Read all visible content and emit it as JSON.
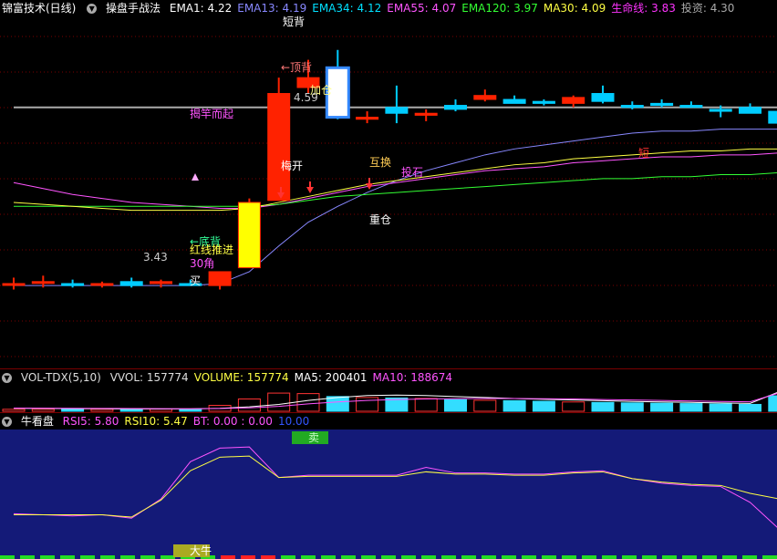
{
  "header": {
    "title": "锦富技术(日线)",
    "indicator": "操盘手战法",
    "items": [
      {
        "label": "EMA1:",
        "value": "4.22",
        "color": "#ffffff"
      },
      {
        "label": "EMA13:",
        "value": "4.19",
        "color": "#8888ff"
      },
      {
        "label": "EMA34:",
        "value": "4.12",
        "color": "#00e0ff"
      },
      {
        "label": "EMA55:",
        "value": "4.07",
        "color": "#ff55ff"
      },
      {
        "label": "EMA120:",
        "value": "3.97",
        "color": "#33ff33"
      },
      {
        "label": "MA30:",
        "value": "4.09",
        "color": "#ffff44"
      },
      {
        "label": "生命线:",
        "value": "3.83",
        "color": "#ff33ff"
      },
      {
        "label": "投资:",
        "value": "4.30",
        "color": "#aaaaaa"
      }
    ]
  },
  "vol_header": {
    "name": "VOL-TDX(5,10)",
    "items": [
      {
        "label": "VVOL:",
        "value": "157774",
        "color": "#dddddd"
      },
      {
        "label": "VOLUME:",
        "value": "157774",
        "color": "#ffff44"
      },
      {
        "label": "MA5:",
        "value": "200401",
        "color": "#ffffff"
      },
      {
        "label": "MA10:",
        "value": "188674",
        "color": "#ff55ff"
      }
    ]
  },
  "rsi_header": {
    "name": "牛看盘",
    "items": [
      {
        "label": "RSI5:",
        "value": "5.80",
        "color": "#ff55ff"
      },
      {
        "label": "RSI10:",
        "value": "5.47",
        "color": "#ffff44"
      },
      {
        "label": "BT:",
        "value": "0.00 : 0.00",
        "color": "#ff55ff"
      },
      {
        "label": "",
        "value": "10.00",
        "color": "#3355ff"
      }
    ]
  },
  "annotations": {
    "top_cut": "短背",
    "top_div": "←顶背",
    "add_pos": "加仓",
    "high_price": "4.59",
    "jiegan": "揭竿而起",
    "meikai": "梅开",
    "huhuan": "互换",
    "toushi": "投石",
    "zhongcang": "重仓",
    "short_label": "短",
    "bottom_div": "←底背",
    "advance": "红线推进",
    "angle": "30角",
    "buy": "买",
    "low_price": "3.43",
    "sell_mark": "卖",
    "bull_mark": "大牛"
  },
  "colors": {
    "up": "#ff2200",
    "down": "#00ccff",
    "grid": "#7a0000"
  },
  "chart_data": [
    {
      "type": "candlestick",
      "name": "price",
      "ylim": [
        3.0,
        4.75
      ],
      "ohlc": [
        [
          3.41,
          3.44,
          3.38,
          3.41
        ],
        [
          3.42,
          3.45,
          3.39,
          3.42
        ],
        [
          3.41,
          3.43,
          3.39,
          3.4
        ],
        [
          3.41,
          3.42,
          3.39,
          3.41
        ],
        [
          3.42,
          3.44,
          3.39,
          3.4
        ],
        [
          3.41,
          3.43,
          3.39,
          3.42
        ],
        [
          3.41,
          3.43,
          3.4,
          3.4
        ],
        [
          3.4,
          3.47,
          3.38,
          3.47
        ],
        [
          3.49,
          3.84,
          3.49,
          3.82
        ],
        [
          3.83,
          4.45,
          3.83,
          4.37
        ],
        [
          4.4,
          4.54,
          4.37,
          4.45
        ],
        [
          4.5,
          4.59,
          4.24,
          4.25
        ],
        [
          4.24,
          4.28,
          4.22,
          4.25
        ],
        [
          4.3,
          4.41,
          4.22,
          4.27
        ],
        [
          4.26,
          4.29,
          4.23,
          4.27
        ],
        [
          4.31,
          4.34,
          4.28,
          4.29
        ],
        [
          4.34,
          4.39,
          4.33,
          4.36
        ],
        [
          4.34,
          4.36,
          4.32,
          4.32
        ],
        [
          4.33,
          4.34,
          4.31,
          4.32
        ],
        [
          4.32,
          4.36,
          4.3,
          4.35
        ],
        [
          4.37,
          4.41,
          4.32,
          4.33
        ],
        [
          4.31,
          4.33,
          4.29,
          4.3
        ],
        [
          4.32,
          4.34,
          4.3,
          4.31
        ],
        [
          4.31,
          4.33,
          4.3,
          4.3
        ],
        [
          4.29,
          4.31,
          4.25,
          4.28
        ],
        [
          4.3,
          4.32,
          4.27,
          4.27
        ],
        [
          4.28,
          4.31,
          4.19,
          4.22
        ]
      ],
      "ma_lines": {
        "EMA13": [
          3.4,
          3.4,
          3.4,
          3.4,
          3.4,
          3.4,
          3.4,
          3.41,
          3.47,
          3.6,
          3.72,
          3.8,
          3.87,
          3.93,
          3.98,
          4.02,
          4.06,
          4.09,
          4.11,
          4.13,
          4.15,
          4.17,
          4.18,
          4.18,
          4.19,
          4.19,
          4.19
        ],
        "EMA55": [
          3.92,
          3.89,
          3.86,
          3.84,
          3.82,
          3.81,
          3.8,
          3.79,
          3.79,
          3.81,
          3.84,
          3.87,
          3.9,
          3.92,
          3.94,
          3.96,
          3.98,
          3.99,
          4.0,
          4.02,
          4.03,
          4.04,
          4.05,
          4.05,
          4.06,
          4.06,
          4.07
        ],
        "EMA120": [
          3.8,
          3.8,
          3.8,
          3.8,
          3.8,
          3.8,
          3.8,
          3.8,
          3.8,
          3.81,
          3.83,
          3.85,
          3.86,
          3.87,
          3.88,
          3.89,
          3.9,
          3.91,
          3.92,
          3.93,
          3.94,
          3.94,
          3.95,
          3.95,
          3.96,
          3.96,
          3.97
        ],
        "MA30": [
          3.82,
          3.81,
          3.8,
          3.79,
          3.78,
          3.78,
          3.78,
          3.78,
          3.79,
          3.82,
          3.85,
          3.88,
          3.91,
          3.93,
          3.95,
          3.97,
          3.99,
          4.01,
          4.02,
          4.04,
          4.05,
          4.06,
          4.07,
          4.08,
          4.08,
          4.09,
          4.09
        ],
        "投资": [
          4.3,
          4.3,
          4.3,
          4.3,
          4.3,
          4.3,
          4.3,
          4.3,
          4.3,
          4.3,
          4.3,
          4.3,
          4.3,
          4.3,
          4.3,
          4.3,
          4.3,
          4.3,
          4.3,
          4.3,
          4.3,
          4.3,
          4.3,
          4.3,
          4.3,
          4.3,
          4.3
        ]
      }
    },
    {
      "type": "bar",
      "name": "volume",
      "ylim": [
        0,
        260000
      ],
      "values": [
        20000,
        21000,
        19000,
        20000,
        21000,
        22000,
        23000,
        60000,
        125000,
        185000,
        180000,
        150000,
        140000,
        135000,
        130000,
        118000,
        112000,
        108000,
        102000,
        95000,
        90000,
        85000,
        82000,
        78000,
        74000,
        70000,
        157774
      ],
      "ma5": [
        30000,
        29000,
        27000,
        25000,
        24000,
        23000,
        24000,
        30000,
        45000,
        70000,
        110000,
        140000,
        160000,
        165000,
        160000,
        150000,
        140000,
        130000,
        122000,
        115000,
        108000,
        100000,
        95000,
        90000,
        85000,
        80000,
        200401
      ],
      "ma10": [
        32000,
        31000,
        30000,
        29000,
        28000,
        27000,
        26000,
        28000,
        35000,
        50000,
        75000,
        95000,
        110000,
        120000,
        125000,
        128000,
        130000,
        130000,
        128000,
        125000,
        120000,
        115000,
        110000,
        105000,
        100000,
        96000,
        188674
      ]
    },
    {
      "type": "line",
      "name": "rsi",
      "ylim": [
        0,
        100
      ],
      "x": [
        0,
        1,
        2,
        3,
        4,
        5,
        6,
        7,
        8,
        9,
        10,
        11,
        12,
        13,
        14,
        15,
        16,
        17,
        18,
        19,
        20,
        21,
        22,
        23,
        24,
        25,
        26
      ],
      "series": [
        {
          "name": "RSI5",
          "values": [
            32,
            31,
            30,
            31,
            28,
            45,
            78,
            90,
            91,
            64,
            66,
            66,
            66,
            66,
            73,
            68,
            68,
            67,
            67,
            69,
            70,
            63,
            59,
            57,
            56,
            42,
            18
          ]
        },
        {
          "name": "RSI10",
          "values": [
            31,
            31,
            31,
            31,
            29,
            44,
            70,
            82,
            83,
            64,
            65,
            65,
            65,
            65,
            69,
            67,
            67,
            66,
            66,
            68,
            69,
            63,
            60,
            58,
            57,
            50,
            45
          ]
        }
      ]
    }
  ]
}
